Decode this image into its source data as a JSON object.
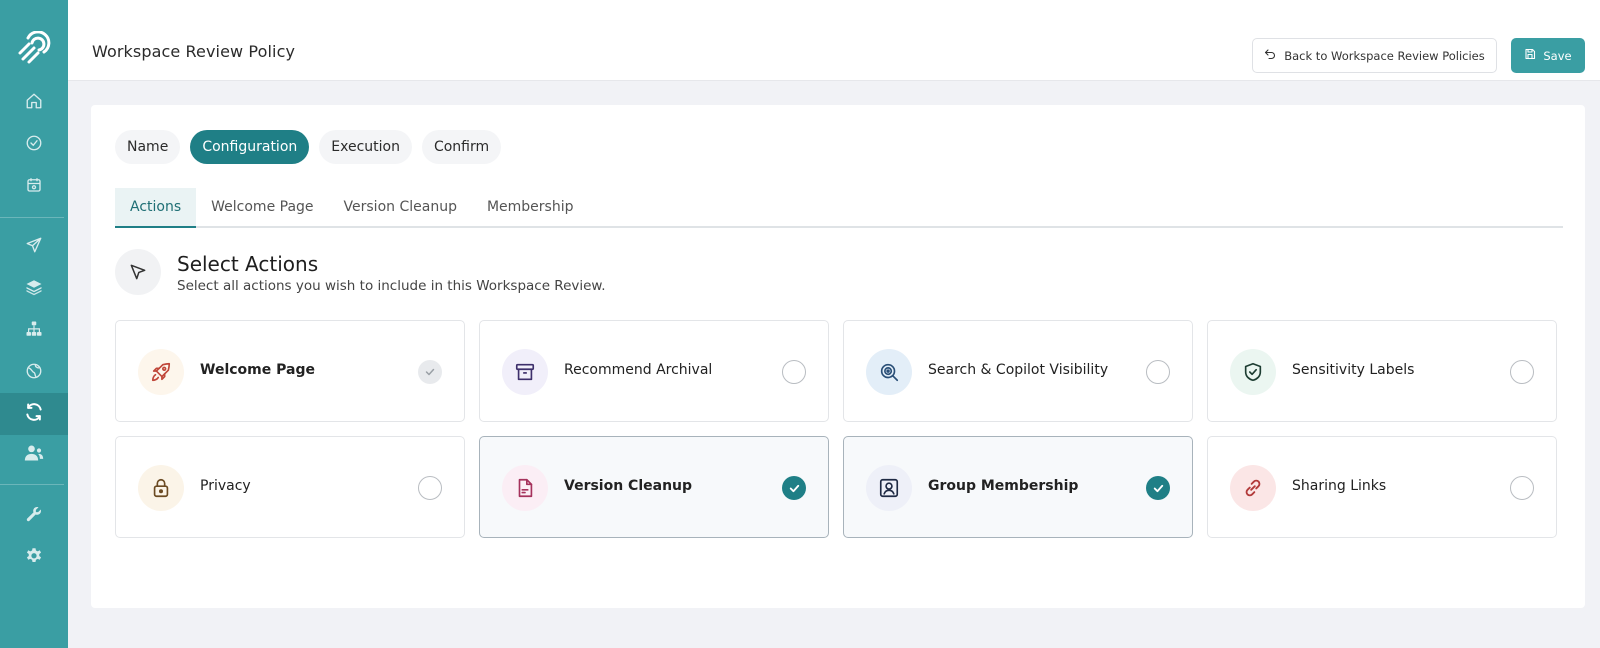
{
  "colors": {
    "sidebar": "#3a9ea3",
    "accent": "#1f7f86"
  },
  "sidebar": {
    "logo_icon": "brand-logo-icon",
    "items": [
      {
        "icon": "home-icon",
        "active": false
      },
      {
        "icon": "check-circle-icon",
        "active": false
      },
      {
        "icon": "calendar-icon",
        "active": false
      },
      {
        "icon": "send-icon",
        "active": false
      },
      {
        "icon": "layers-icon",
        "active": false
      },
      {
        "icon": "hierarchy-icon",
        "active": false
      },
      {
        "icon": "globe-icon",
        "active": false
      },
      {
        "icon": "refresh-icon",
        "active": true
      },
      {
        "icon": "users-icon",
        "active": false
      },
      {
        "icon": "wrench-icon",
        "active": false
      },
      {
        "icon": "gear-icon",
        "active": false
      }
    ]
  },
  "header": {
    "title": "Workspace Review Policy",
    "back_label": "Back to Workspace Review Policies",
    "save_label": "Save"
  },
  "steps": [
    {
      "label": "Name",
      "active": false
    },
    {
      "label": "Configuration",
      "active": true
    },
    {
      "label": "Execution",
      "active": false
    },
    {
      "label": "Confirm",
      "active": false
    }
  ],
  "subtabs": [
    {
      "label": "Actions",
      "active": true
    },
    {
      "label": "Welcome Page",
      "active": false
    },
    {
      "label": "Version Cleanup",
      "active": false
    },
    {
      "label": "Membership",
      "active": false
    }
  ],
  "section": {
    "title": "Select Actions",
    "subtitle": "Select all actions you wish to include in this Workspace Review."
  },
  "actions": [
    {
      "label": "Welcome Page",
      "icon": "rocket-icon",
      "state": "locked",
      "bg": "#fdf6ec",
      "fg": "#c0473a"
    },
    {
      "label": "Recommend Archival",
      "icon": "archive-icon",
      "state": "off",
      "bg": "#f1effa",
      "fg": "#3d2f6b"
    },
    {
      "label": "Search & Copilot Visibility",
      "icon": "search-visibility-icon",
      "state": "off",
      "bg": "#e3eef8",
      "fg": "#2a4f77"
    },
    {
      "label": "Sensitivity Labels",
      "icon": "shield-check-icon",
      "state": "off",
      "bg": "#ebf6f1",
      "fg": "#1d3d32"
    },
    {
      "label": "Privacy",
      "icon": "lock-icon",
      "state": "off",
      "bg": "#fbf4e8",
      "fg": "#6b4a22"
    },
    {
      "label": "Version Cleanup",
      "icon": "file-icon",
      "state": "on",
      "bg": "#fbeef5",
      "fg": "#a5325c"
    },
    {
      "label": "Group Membership",
      "icon": "user-badge-icon",
      "state": "on",
      "bg": "#eef0f8",
      "fg": "#1f2a44"
    },
    {
      "label": "Sharing Links",
      "icon": "link-icon",
      "state": "off",
      "bg": "#fbe6e6",
      "fg": "#b23a3a"
    }
  ]
}
